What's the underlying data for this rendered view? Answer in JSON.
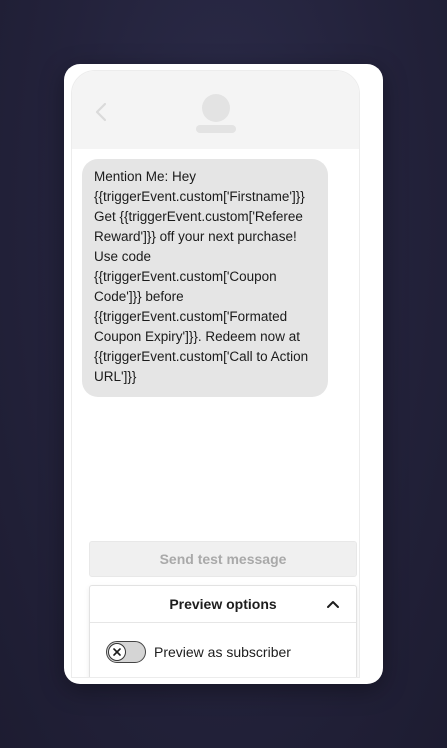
{
  "message": {
    "text": "Mention Me: Hey {{triggerEvent.custom['Firstname']}} Get {{triggerEvent.custom['Referee Reward']}} off your next purchase! Use code {{triggerEvent.custom['Coupon Code']}} before {{triggerEvent.custom['Formated Coupon Expiry']}}. Redeem now at {{triggerEvent.custom['Call to Action URL']}}"
  },
  "actions": {
    "send_test_label": "Send test message"
  },
  "preview_options": {
    "title": "Preview options",
    "expanded": true,
    "toggle_label": "Preview as subscriber",
    "toggle_on": false
  },
  "icons": {
    "back": "chevron-left-icon",
    "collapse": "chevron-up-icon",
    "toggle_knob": "close-icon"
  },
  "colors": {
    "background": "#23223b",
    "bubble": "#e5e5e5",
    "disabled_text": "#a9a9a9"
  }
}
